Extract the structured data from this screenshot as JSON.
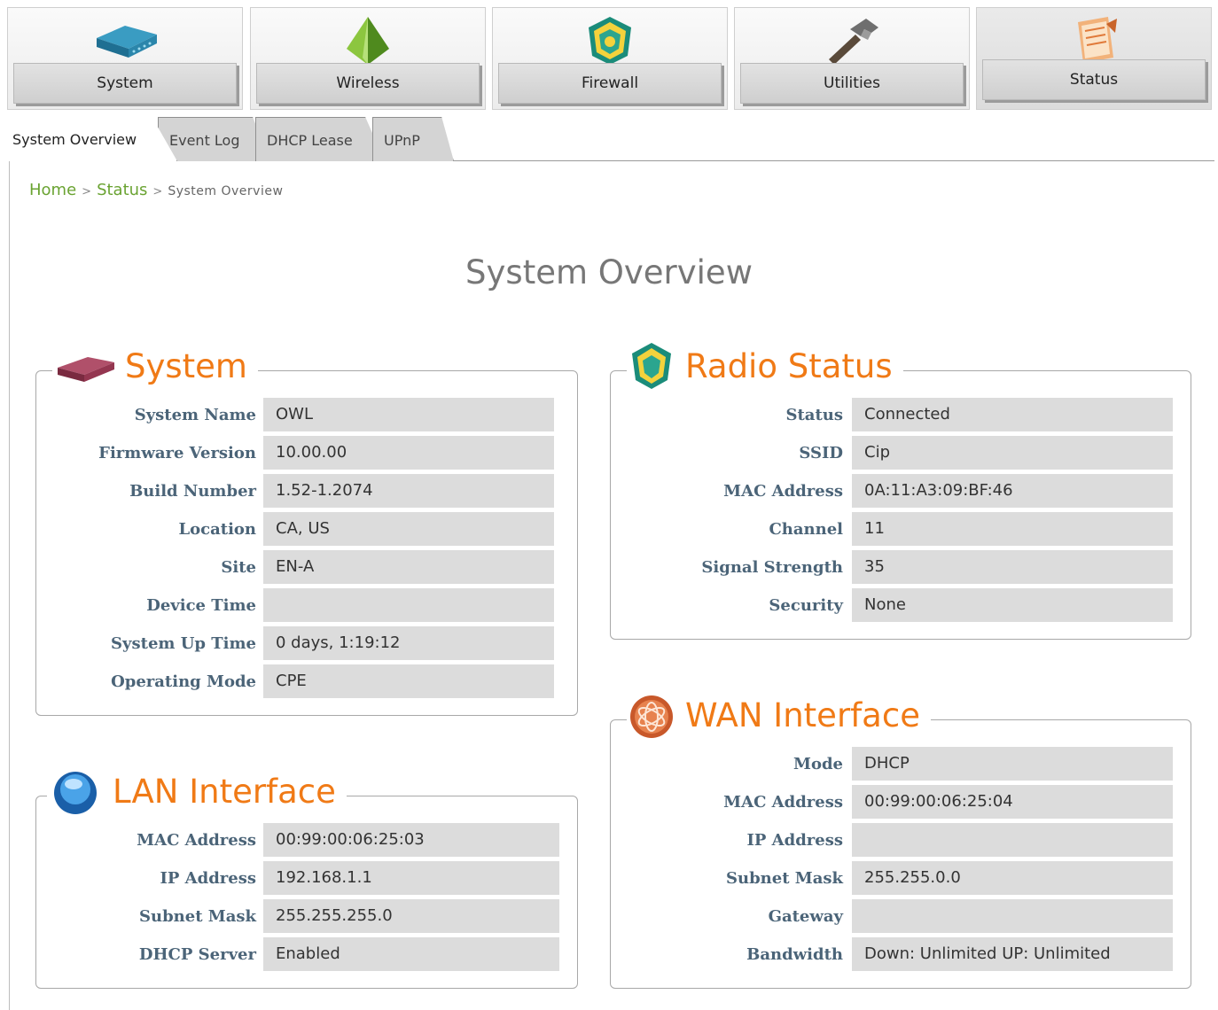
{
  "nav": {
    "items": [
      {
        "label": "System",
        "icon": "router-icon"
      },
      {
        "label": "Wireless",
        "icon": "pyramid-icon"
      },
      {
        "label": "Firewall",
        "icon": "shield-icon"
      },
      {
        "label": "Utilities",
        "icon": "hammer-icon"
      },
      {
        "label": "Status",
        "icon": "notepad-icon"
      }
    ],
    "active": "Status"
  },
  "tabs": [
    {
      "label": "System Overview",
      "active": true
    },
    {
      "label": "Event Log",
      "active": false
    },
    {
      "label": "DHCP Lease",
      "active": false
    },
    {
      "label": "UPnP",
      "active": false
    }
  ],
  "breadcrumb": {
    "home": "Home",
    "section": "Status",
    "current": "System Overview",
    "sep": ">"
  },
  "page_title": "System Overview",
  "system": {
    "title": "System",
    "rows": [
      {
        "label": "System Name",
        "value": "OWL"
      },
      {
        "label": "Firmware Version",
        "value": "10.00.00"
      },
      {
        "label": "Build Number",
        "value": "1.52-1.2074"
      },
      {
        "label": "Location",
        "value": "CA, US"
      },
      {
        "label": "Site",
        "value": "EN-A"
      },
      {
        "label": "Device Time",
        "value": ""
      },
      {
        "label": "System Up Time",
        "value": "0 days, 1:19:12"
      },
      {
        "label": "Operating Mode",
        "value": "CPE"
      }
    ]
  },
  "lan": {
    "title": "LAN Interface",
    "rows": [
      {
        "label": "MAC Address",
        "value": "00:99:00:06:25:03"
      },
      {
        "label": "IP Address",
        "value": "192.168.1.1"
      },
      {
        "label": "Subnet Mask",
        "value": "255.255.255.0"
      },
      {
        "label": "DHCP Server",
        "value": "Enabled"
      }
    ]
  },
  "radio": {
    "title": "Radio Status",
    "rows": [
      {
        "label": "Status",
        "value": "Connected"
      },
      {
        "label": "SSID",
        "value": "Cip"
      },
      {
        "label": "MAC Address",
        "value": "0A:11:A3:09:BF:46"
      },
      {
        "label": "Channel",
        "value": "11"
      },
      {
        "label": "Signal Strength",
        "value": "35"
      },
      {
        "label": "Security",
        "value": "None"
      }
    ]
  },
  "wan": {
    "title": "WAN Interface",
    "rows": [
      {
        "label": "Mode",
        "value": "DHCP"
      },
      {
        "label": "MAC Address",
        "value": "00:99:00:06:25:04"
      },
      {
        "label": "IP Address",
        "value": ""
      },
      {
        "label": "Subnet Mask",
        "value": "255.255.0.0"
      },
      {
        "label": "Gateway",
        "value": ""
      },
      {
        "label": "Bandwidth",
        "value": "Down: Unlimited UP: Unlimited"
      }
    ]
  },
  "colors": {
    "accent_title": "#f07a16",
    "label": "#4b6478",
    "link": "#6aa332",
    "value_bg": "#dcdcdc"
  }
}
